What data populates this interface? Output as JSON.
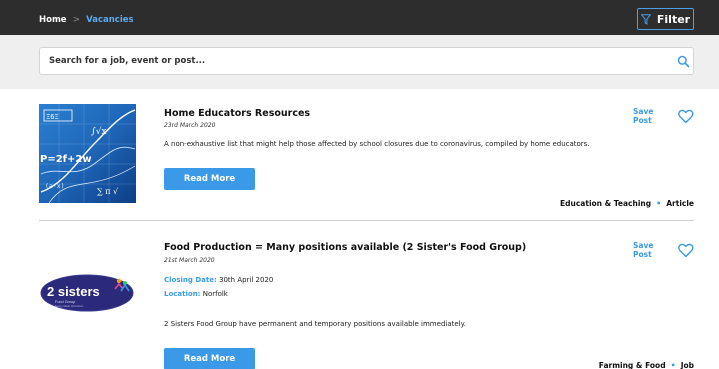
{
  "breadcrumb": {
    "home": "Home",
    "separator": ">",
    "current": "Vacancies"
  },
  "filter": {
    "label": "Filter",
    "icon": "filter-icon"
  },
  "search": {
    "placeholder": "Search for a job, event or post...",
    "icon": "search-icon"
  },
  "colors": {
    "accent": "#3a9ae8",
    "topbar": "#2d2d2d",
    "search_band": "#efefef"
  },
  "posts": [
    {
      "title": "Home Educators Resources",
      "date": "23rd March 2020",
      "excerpt": "A non-exhaustive list that might help those affected by school closures due to coronavirus, compiled by home educators.",
      "button": "Read More",
      "save_label": "Save Post",
      "category": "Education & Teaching",
      "type": "Article",
      "thumbnail": "math-formulas-image"
    },
    {
      "title": "Food Production = Many positions available (2 Sister's Food Group)",
      "date": "21st March 2020",
      "closing_label": "Closing Date:",
      "closing_value": "30th April 2020",
      "location_label": "Location:",
      "location_value": "Norfolk",
      "excerpt": "2 Sisters Food Group have permanent and temporary positions available immediately.",
      "button": "Read More",
      "save_label": "Save Post",
      "category": "Farming & Food",
      "type": "Job",
      "thumbnail": "2-sisters-logo",
      "logo": {
        "name": "2 sisters",
        "sub": "Food Group",
        "tagline": "Every Meal Occasion"
      }
    }
  ]
}
